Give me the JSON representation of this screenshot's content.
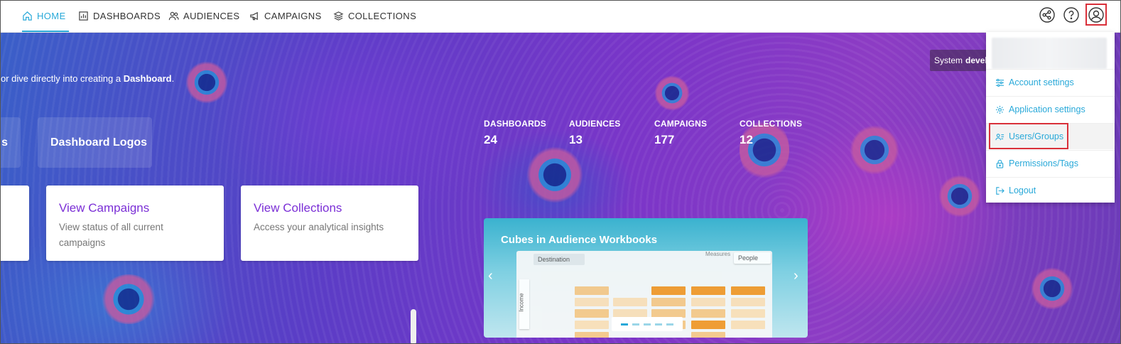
{
  "nav": {
    "items": [
      {
        "label": "HOME",
        "icon": "home-icon",
        "active": true
      },
      {
        "label": "DASHBOARDS",
        "icon": "dashboard-icon",
        "active": false
      },
      {
        "label": "AUDIENCES",
        "icon": "people-icon",
        "active": false
      },
      {
        "label": "CAMPAIGNS",
        "icon": "megaphone-icon",
        "active": false
      },
      {
        "label": "COLLECTIONS",
        "icon": "layers-icon",
        "active": false
      }
    ],
    "right_icons": [
      "share-icon",
      "help-icon",
      "user-profile-icon"
    ],
    "accent_color": "#29a9d9"
  },
  "hero": {
    "intro_prefix": "or dive directly into creating a ",
    "intro_bold": "Dashboard",
    "intro_suffix": ".",
    "tile_partial": "s",
    "tile_logos": "Dashboard Logos"
  },
  "stats": [
    {
      "label": "DASHBOARDS",
      "value": "24"
    },
    {
      "label": "AUDIENCES",
      "value": "13"
    },
    {
      "label": "CAMPAIGNS",
      "value": "177"
    },
    {
      "label": "COLLECTIONS",
      "value": "12"
    }
  ],
  "cards": [
    {
      "title": "View Campaigns",
      "desc": "View status of all current campaigns"
    },
    {
      "title": "View Collections",
      "desc": "Access your analytical insights"
    }
  ],
  "carousel": {
    "title": "Cubes in Audience Workbooks",
    "mock_destination": "Destination",
    "mock_measures": "Measures",
    "mock_people": "People",
    "mock_income": "Income",
    "slides": 5,
    "active_slide": 1
  },
  "tooltip": {
    "prefix": "System",
    "bold": "develo"
  },
  "dropdown": {
    "items": [
      {
        "label": "Account settings",
        "icon": "sliders-icon"
      },
      {
        "label": "Application settings",
        "icon": "gear-icon"
      },
      {
        "label": "Users/Groups",
        "icon": "users-list-icon"
      },
      {
        "label": "Permissions/Tags",
        "icon": "lock-icon"
      },
      {
        "label": "Logout",
        "icon": "logout-icon"
      }
    ],
    "selected": "Users/Groups"
  },
  "colors": {
    "highlight": "#d9303a",
    "card_title": "#7b2fd6"
  }
}
